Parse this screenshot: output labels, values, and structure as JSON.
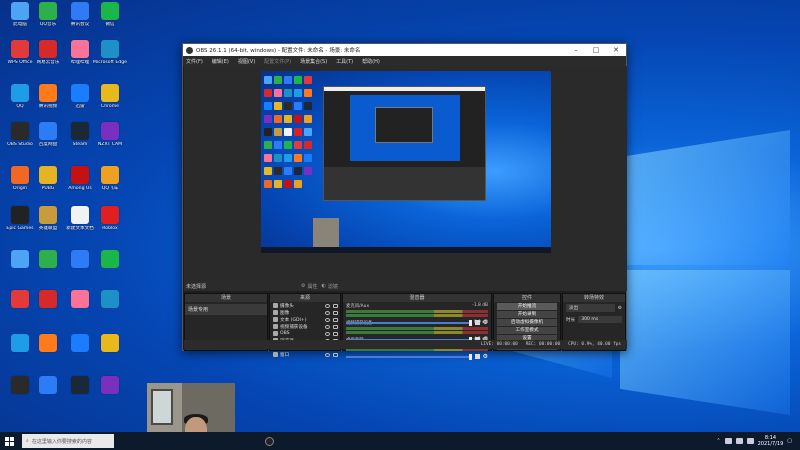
{
  "desktop": {
    "icons": [
      {
        "label": "此电脑",
        "color": "#4da3f5"
      },
      {
        "label": "QQ音乐",
        "color": "#2db04b"
      },
      {
        "label": "腾讯会议",
        "color": "#2f7bf5"
      },
      {
        "label": "微信",
        "color": "#1bb64a"
      },
      {
        "label": "WPS Office",
        "color": "#e2393a"
      },
      {
        "label": "网易云音乐",
        "color": "#d62a2a"
      },
      {
        "label": "哔哩哔哩",
        "color": "#fb7299"
      },
      {
        "label": "Microsoft Edge",
        "color": "#1e90c8"
      },
      {
        "label": "QQ",
        "color": "#1f9ce8"
      },
      {
        "label": "腾讯视频",
        "color": "#ff7a1a"
      },
      {
        "label": "迅雷",
        "color": "#1a7cff"
      },
      {
        "label": "Chrome",
        "color": "#e8b91c"
      },
      {
        "label": "OBS Studio",
        "color": "#2a2a2a"
      },
      {
        "label": "百度网盘",
        "color": "#2b7cf6"
      },
      {
        "label": "Steam",
        "color": "#1b2838"
      },
      {
        "label": "NZXT CAM",
        "color": "#7b2fbf"
      },
      {
        "label": "Origin",
        "color": "#f26722"
      },
      {
        "label": "PUBG",
        "color": "#e6b422"
      },
      {
        "label": "Among Us",
        "color": "#c51111"
      },
      {
        "label": "QQ飞车",
        "color": "#f0a020"
      },
      {
        "label": "Epic Games",
        "color": "#222222"
      },
      {
        "label": "英雄联盟",
        "color": "#c89b3c"
      },
      {
        "label": "新建文本文档",
        "color": "#f2f2f2"
      },
      {
        "label": "Roblox",
        "color": "#e02020"
      }
    ]
  },
  "obs": {
    "title": "OBS 26.1.1 (64-bit, windows) - 配置文件: 未命名 - 场景: 未命名",
    "menu": [
      "文件(F)",
      "编辑(E)",
      "视图(V)",
      "配置文件(P)",
      "场景集合(S)",
      "工具(T)",
      "帮助(H)"
    ],
    "source_bar": {
      "label": "未选择源",
      "props_label": "属性",
      "filters_label": "滤镜"
    },
    "docks": {
      "scenes": {
        "header": "场景",
        "items": [
          "场景专用"
        ]
      },
      "sources": {
        "header": "来源",
        "items": [
          "摄像头",
          "图像",
          "文本 (GDI+)",
          "视频捕获设备",
          "OBS",
          "浏览器",
          "显示器捕获",
          "窗口"
        ]
      },
      "mixer": {
        "header": "混音器",
        "tracks": [
          {
            "name": "麦克风/Aux",
            "db": "-1.8 dB"
          },
          {
            "name": "视频捕获设备",
            "db": "0.0 dB"
          },
          {
            "name": "桌面音频",
            "db": "-4.5 dB"
          }
        ]
      },
      "controls": {
        "header": "控件",
        "buttons": [
          "开始推流",
          "开始录制",
          "启动虚拟摄像机",
          "工作室模式",
          "设置",
          "退出"
        ]
      },
      "transitions": {
        "header": "转场特效",
        "type": "淡出",
        "duration_label": "时长",
        "duration": "300 ms"
      }
    },
    "status": {
      "live": "LIVE: 00:00:00",
      "rec": "REC: 00:00:00",
      "cpu": "CPU: 0.9%, 40.00 fps"
    }
  },
  "taskbar": {
    "search_placeholder": "在这里输入你要搜索的内容",
    "time": "8:14",
    "date": "2021/7/19"
  }
}
